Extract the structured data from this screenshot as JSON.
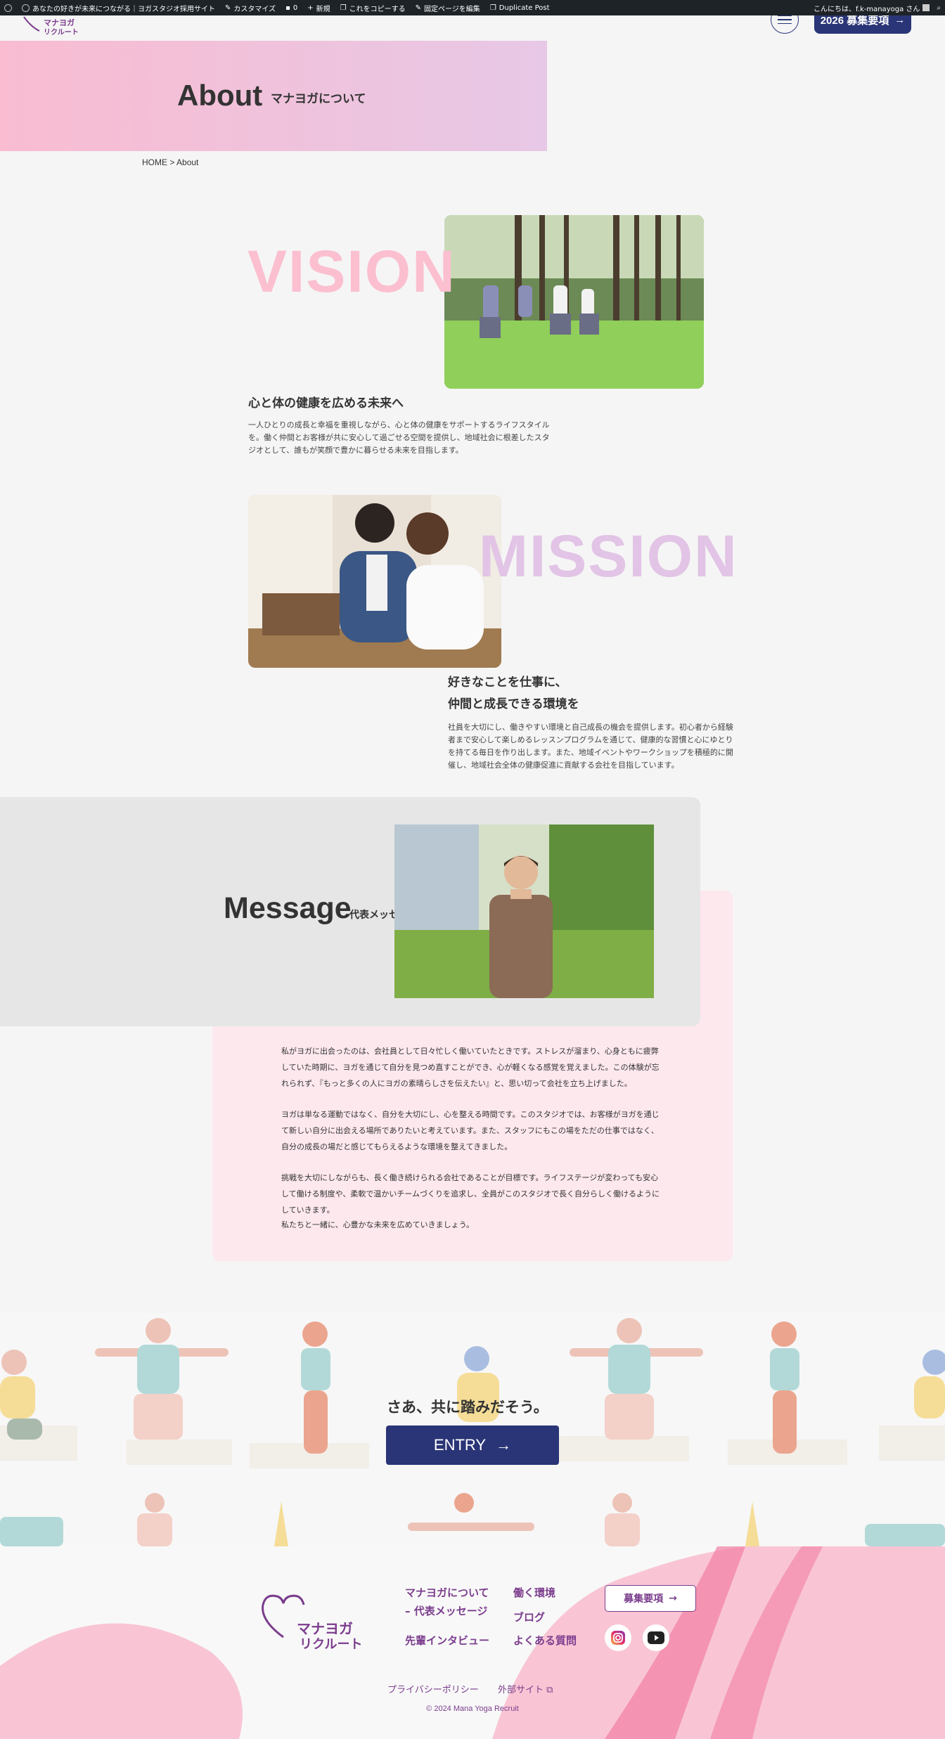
{
  "adminbar": {
    "site": "あなたの好きが未来につながる｜ヨガスタジオ採用サイト",
    "customize": "カスタマイズ",
    "comments": "0",
    "new": "新規",
    "copy": "これをコピーする",
    "edit": "固定ページを編集",
    "duplicate": "Duplicate Post",
    "greeting": "こんにちは、f.k-manayoga さん"
  },
  "header": {
    "logo_line1": "マナヨガ",
    "logo_line2": "リクルート",
    "recruit_label": "2026 募集要項",
    "arrow": "→"
  },
  "hero": {
    "title": "About",
    "subtitle": "マナヨガについて"
  },
  "breadcrumb": "HOME > About",
  "vision": {
    "word": "VISION",
    "title": "心と体の健康を広める未来へ",
    "body": "一人ひとりの成長と幸福を重視しながら、心と体の健康をサポートするライフスタイルを。働く仲間とお客様が共に安心して過ごせる空間を提供し、地域社会に根差したスタジオとして、誰もが笑顔で豊かに暮らせる未来を目指します。"
  },
  "mission": {
    "word": "MISSION",
    "title_line1": "好きなことを仕事に、",
    "title_line2": "仲間と成長できる環境を",
    "body": "社員を大切にし、働きやすい環境と自己成長の機会を提供します。初心者から経験者まで安心して楽しめるレッスンプログラムを通じて、健康的な習慣と心にゆとりを持てる毎日を作り出します。また、地域イベントやワークショップを積極的に開催し、地域社会全体の健康促進に貢献する会社を目指しています。"
  },
  "message": {
    "title": "Message",
    "subtitle": "代表メッセージ",
    "p1": "私がヨガに出会ったのは、会社員として日々忙しく働いていたときです。ストレスが溜まり、心身ともに疲弊していた時期に、ヨガを通じて自分を見つめ直すことができ、心が軽くなる感覚を覚えました。この体験が忘れられず、『もっと多くの人にヨガの素晴らしさを伝えたい』と、思い切って会社を立ち上げました。",
    "p2": "ヨガは単なる運動ではなく、自分を大切にし、心を整える時間です。このスタジオでは、お客様がヨガを通じて新しい自分に出会える場所でありたいと考えています。また、スタッフにもこの場をただの仕事ではなく、自分の成長の場だと感じてもらえるような環境を整えてきました。",
    "p3": "挑戦を大切にしながらも、長く働き続けられる会社であることが目標です。ライフステージが変わっても安心して働ける制度や、柔軟で温かいチームづくりを追求し、全員がこのスタジオで長く自分らしく働けるようにしていきます。",
    "p4": "私たちと一緒に、心豊かな未来を広めていきましょう。"
  },
  "entry": {
    "title": "さあ、共に踏みだそう。",
    "button": "ENTRY",
    "arrow": "→"
  },
  "footer": {
    "logo_line1": "マナヨガ",
    "logo_line2": "リクルート",
    "link_about": "マナヨガについて",
    "link_message": "– 代表メッセージ",
    "link_interview": "先輩インタビュー",
    "link_env": "働く環境",
    "link_blog": "ブログ",
    "link_faq": "よくある質問",
    "recruit": "募集要項",
    "recruit_arrow": "→",
    "privacy": "プライバシーポリシー",
    "external": "外部サイト",
    "copyright": "© 2024 Mana Yoga Recruit"
  },
  "colors": {
    "navy": "#2a3577",
    "pink": "#fbbfd0",
    "lavender": "#e2c4e6",
    "purple": "#7b3d8d"
  }
}
